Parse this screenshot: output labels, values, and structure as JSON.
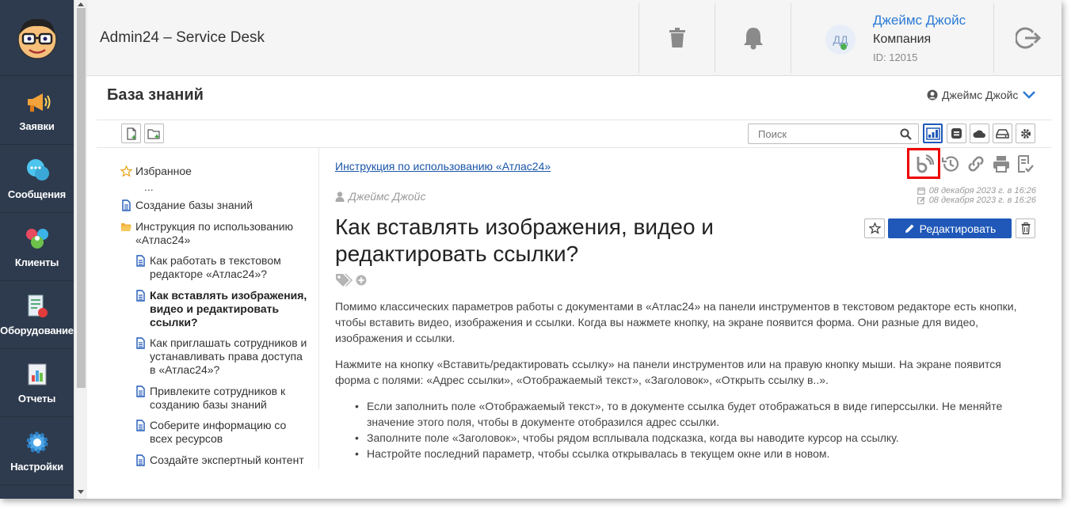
{
  "app": {
    "title": "Admin24 – Service Desk"
  },
  "sidebar": {
    "items": [
      {
        "label": "Заявки",
        "icon": "megaphone-icon"
      },
      {
        "label": "Сообщения",
        "icon": "chat-bubbles-icon"
      },
      {
        "label": "Клиенты",
        "icon": "clients-icon"
      },
      {
        "label": "Оборудование",
        "icon": "equipment-icon"
      },
      {
        "label": "Отчеты",
        "icon": "reports-icon"
      },
      {
        "label": "Настройки",
        "icon": "settings-gear-icon"
      }
    ]
  },
  "header": {
    "avatar_initials": "ДД",
    "user_name": "Джеймс Джойс",
    "company": "Компания",
    "user_id": "ID: 12015"
  },
  "page": {
    "title": "База знаний",
    "current_user": "Джеймс Джойс"
  },
  "search": {
    "placeholder": "Поиск"
  },
  "tree": {
    "favorites": "Избранное",
    "ellipsis": "...",
    "items": [
      {
        "label": "Создание базы знаний"
      },
      {
        "label": "Инструкция по использованию «Атлас24»"
      },
      {
        "label": "Как работать в текстовом редакторе «Атлас24»?"
      },
      {
        "label": "Как вставлять изображения, видео и редактировать ссылки?"
      },
      {
        "label": "Как приглашать сотрудников и устанавливать права доступа в «Атлас24»?"
      },
      {
        "label": "Привлеките сотрудников к созданию базы знаний"
      },
      {
        "label": "Соберите информацию со всех ресурсов"
      },
      {
        "label": "Создайте экспертный контент"
      }
    ]
  },
  "article": {
    "breadcrumb": "Инструкция по использованию «Атлас24»",
    "author": "Джеймс Джойс",
    "created": "08 декабря 2023 г. в 16:26",
    "edited": "08 декабря 2023 г. в 16:26",
    "title": "Как вставлять изображения, видео и редактировать ссылки?",
    "edit_label": "Редактировать",
    "paragraphs": [
      "Помимо классических параметров работы с документами в «Атлас24» на панели инструментов в текстовом редакторе есть кнопки, чтобы вставить видео, изображения и ссылки. Когда вы нажмете кнопку, на экране появится форма. Они разные для видео, изображения и ссылки.",
      "Нажмите на кнопку «Вставить/редактировать ссылку» на панели инструментов или на правую кнопку мыши. На экране появится форма с полями: «Адрес ссылки», «Отображаемый текст», «Заголовок», «Открыть ссылку в..»."
    ],
    "bullets": [
      "Если заполнить поле «Отображаемый текст», то в документе ссылка будет отображаться в виде гиперссылки. Не меняйте значение этого поля, чтобы в документе отобразился адрес ссылки.",
      "Заполните поле «Заголовок», чтобы рядом всплывала подсказка, когда вы наводите курсор на ссылку.",
      "Настройте последний параметр, чтобы ссылка открывалась в текущем окне или в новом."
    ]
  },
  "colors": {
    "sidebar_bg": "#2e3b4e",
    "accent": "#1f58b8",
    "link": "#2a7ad5",
    "highlight": "#e00000"
  }
}
